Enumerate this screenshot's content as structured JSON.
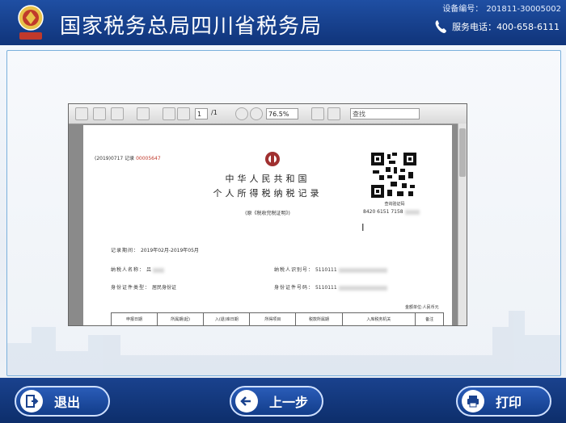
{
  "header": {
    "title": "国家税务总局四川省税务局",
    "device_label": "设备编号：",
    "device_no": "201811-30005002",
    "phone_label": "服务电话：",
    "phone": "400-658-6111"
  },
  "viewer": {
    "toolbar": {
      "page_current": "1",
      "page_total": "/1",
      "zoom": "76.5%",
      "find_placeholder": "查找"
    }
  },
  "document": {
    "record_prefix": "(2019)0717",
    "record_label": "记录",
    "record_no": "00005647",
    "title_line1": "中华人民共和国",
    "title_line2": "个人所得税纳税记录",
    "subtitle": "(原《税收完税证明》)",
    "qr_caption": "查询验证码",
    "qr_code": "8420 6151 7158",
    "period_label": "记录期间：",
    "period_value": "2019年02月-2019年05月",
    "name_label": "纳税人名称：",
    "name_value": "吕",
    "taxpayer_id_label": "纳税人识别号：",
    "taxpayer_id_value": "5110111",
    "id_type_label": "身份证件类型：",
    "id_type_value": "居民身份证",
    "id_no_label": "身份证件号码：",
    "id_no_value": "5110111",
    "unit_note": "金额单位:人民币元",
    "table_headers": [
      "申报日期",
      "所属期(起)",
      "入(退)库日期",
      "所得项目",
      "税款所属期",
      "入库税务机关",
      "",
      "备注"
    ]
  },
  "footer": {
    "exit_label": "退出",
    "back_label": "上一步",
    "print_label": "打印"
  },
  "colors": {
    "header_bg": "#1a428e",
    "accent_red": "#c0392b"
  }
}
